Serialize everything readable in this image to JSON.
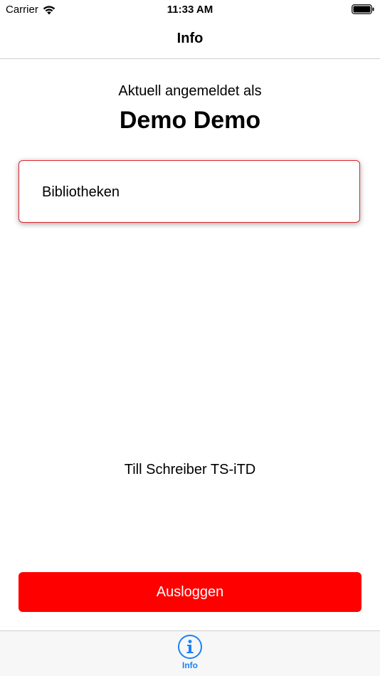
{
  "status_bar": {
    "carrier": "Carrier",
    "time": "11:33 AM"
  },
  "nav": {
    "title": "Info"
  },
  "account": {
    "subtitle": "Aktuell angemeldet als",
    "user_name": "Demo Demo"
  },
  "menu": {
    "libraries_label": "Bibliotheken"
  },
  "footer": {
    "credit": "Till Schreiber TS-iTD",
    "logout_label": "Ausloggen"
  },
  "tab_bar": {
    "tabs": [
      {
        "label": "Info",
        "icon": "info-icon",
        "selected": true
      }
    ]
  },
  "colors": {
    "accent_red": "#fe0000",
    "card_border": "#e0242b",
    "tab_active": "#1a82f7"
  }
}
